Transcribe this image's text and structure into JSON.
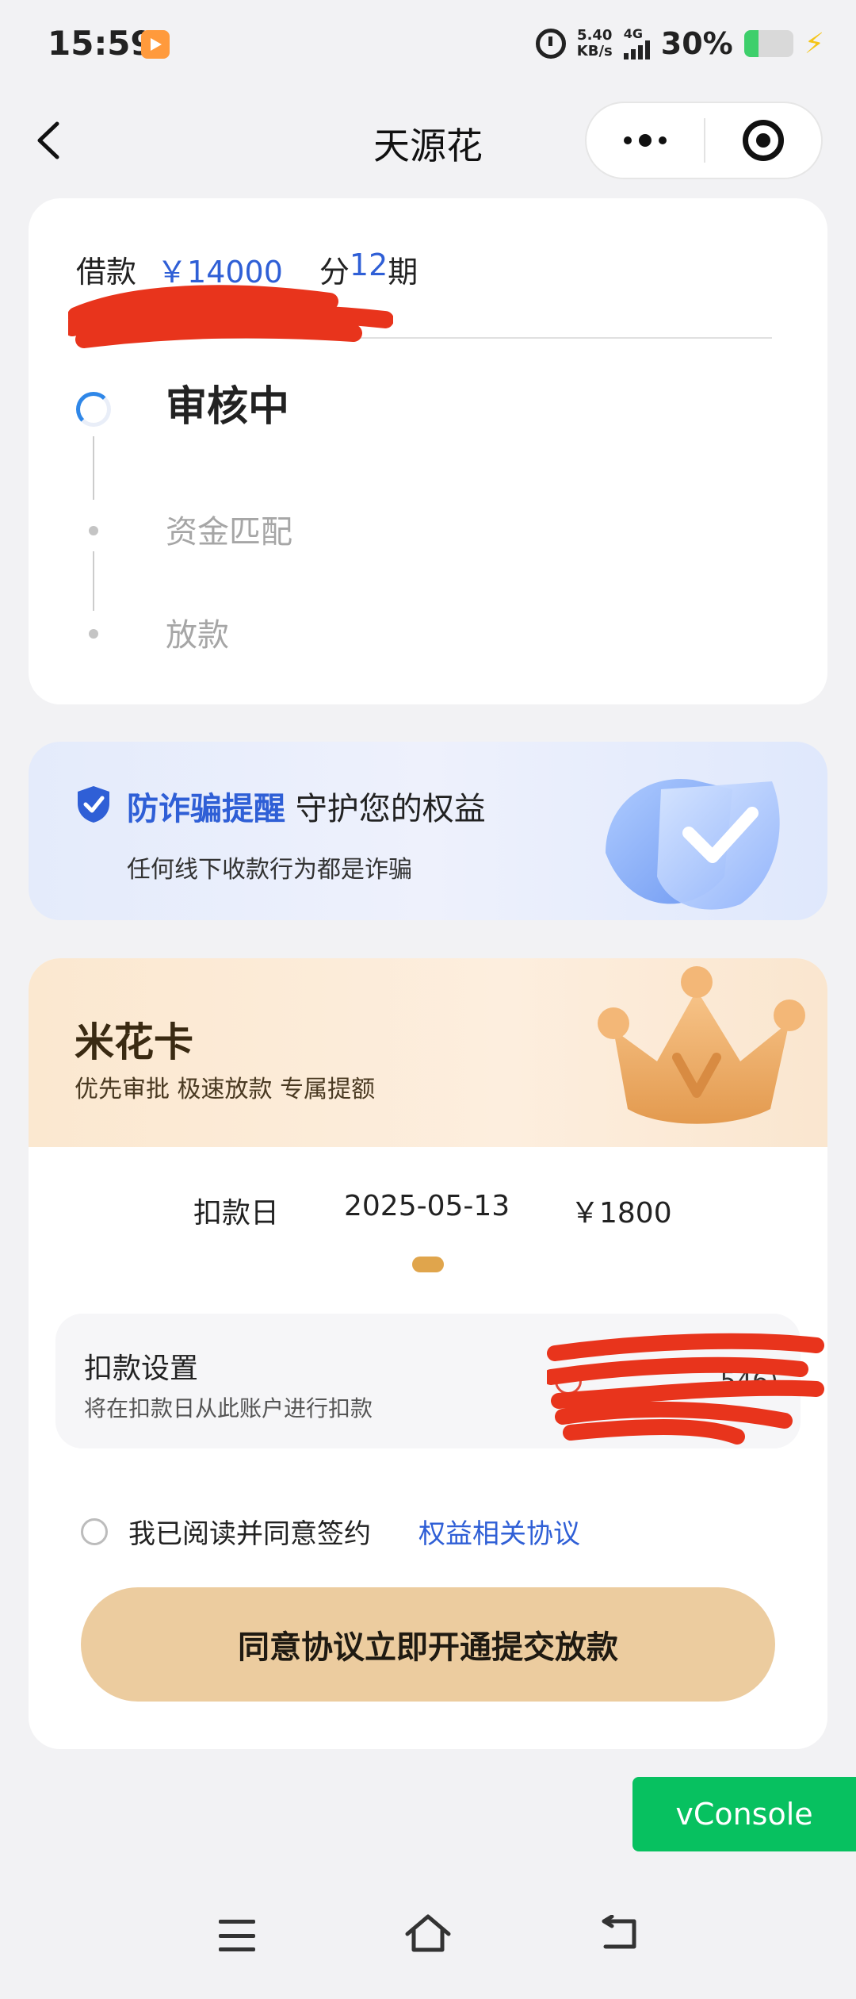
{
  "status_bar": {
    "time": "15:59",
    "net_speed_value": "5.40",
    "net_speed_unit": "KB/s",
    "network_type": "4G",
    "battery": "30%",
    "icons": [
      "app-notification-icon",
      "alarm-icon",
      "signal-icon",
      "battery-icon",
      "charging-bolt-icon"
    ]
  },
  "nav": {
    "title": "天源花",
    "icons": [
      "back-icon",
      "more-icon",
      "close-miniprogram-icon"
    ]
  },
  "loan": {
    "label": "借款",
    "amount": "￥14000",
    "installments_prefix": "分",
    "installments": "12",
    "installments_suffix": "期",
    "steps": [
      {
        "label": "审核中",
        "state": "active"
      },
      {
        "label": "资金匹配",
        "state": "pending"
      },
      {
        "label": "放款",
        "state": "pending"
      }
    ]
  },
  "fraud_notice": {
    "title": "防诈骗提醒",
    "subtitle_inline": "守护您的权益",
    "description": "任何线下收款行为都是诈骗",
    "icons": [
      "shield-icon",
      "check-badge-icon"
    ]
  },
  "membership": {
    "title": "米花卡",
    "benefits": "优先审批 极速放款 专属提额",
    "deduct_label": "扣款日",
    "deduct_date": "2025-05-13",
    "deduct_amount": "￥1800",
    "setting_title": "扣款设置",
    "setting_desc": "将在扣款日从此账户进行扣款",
    "account_suffix": "546)",
    "agree_text": "我已阅读并同意签约",
    "agree_link": "权益相关协议",
    "submit_label": "同意协议立即开通提交放款",
    "accent_color": "#eccc9f",
    "icons": [
      "crown-icon",
      "bank-icon"
    ]
  },
  "debug": {
    "vconsole_label": "vConsole"
  },
  "system_nav": {
    "icons": [
      "menu-icon",
      "home-icon",
      "return-icon"
    ]
  }
}
